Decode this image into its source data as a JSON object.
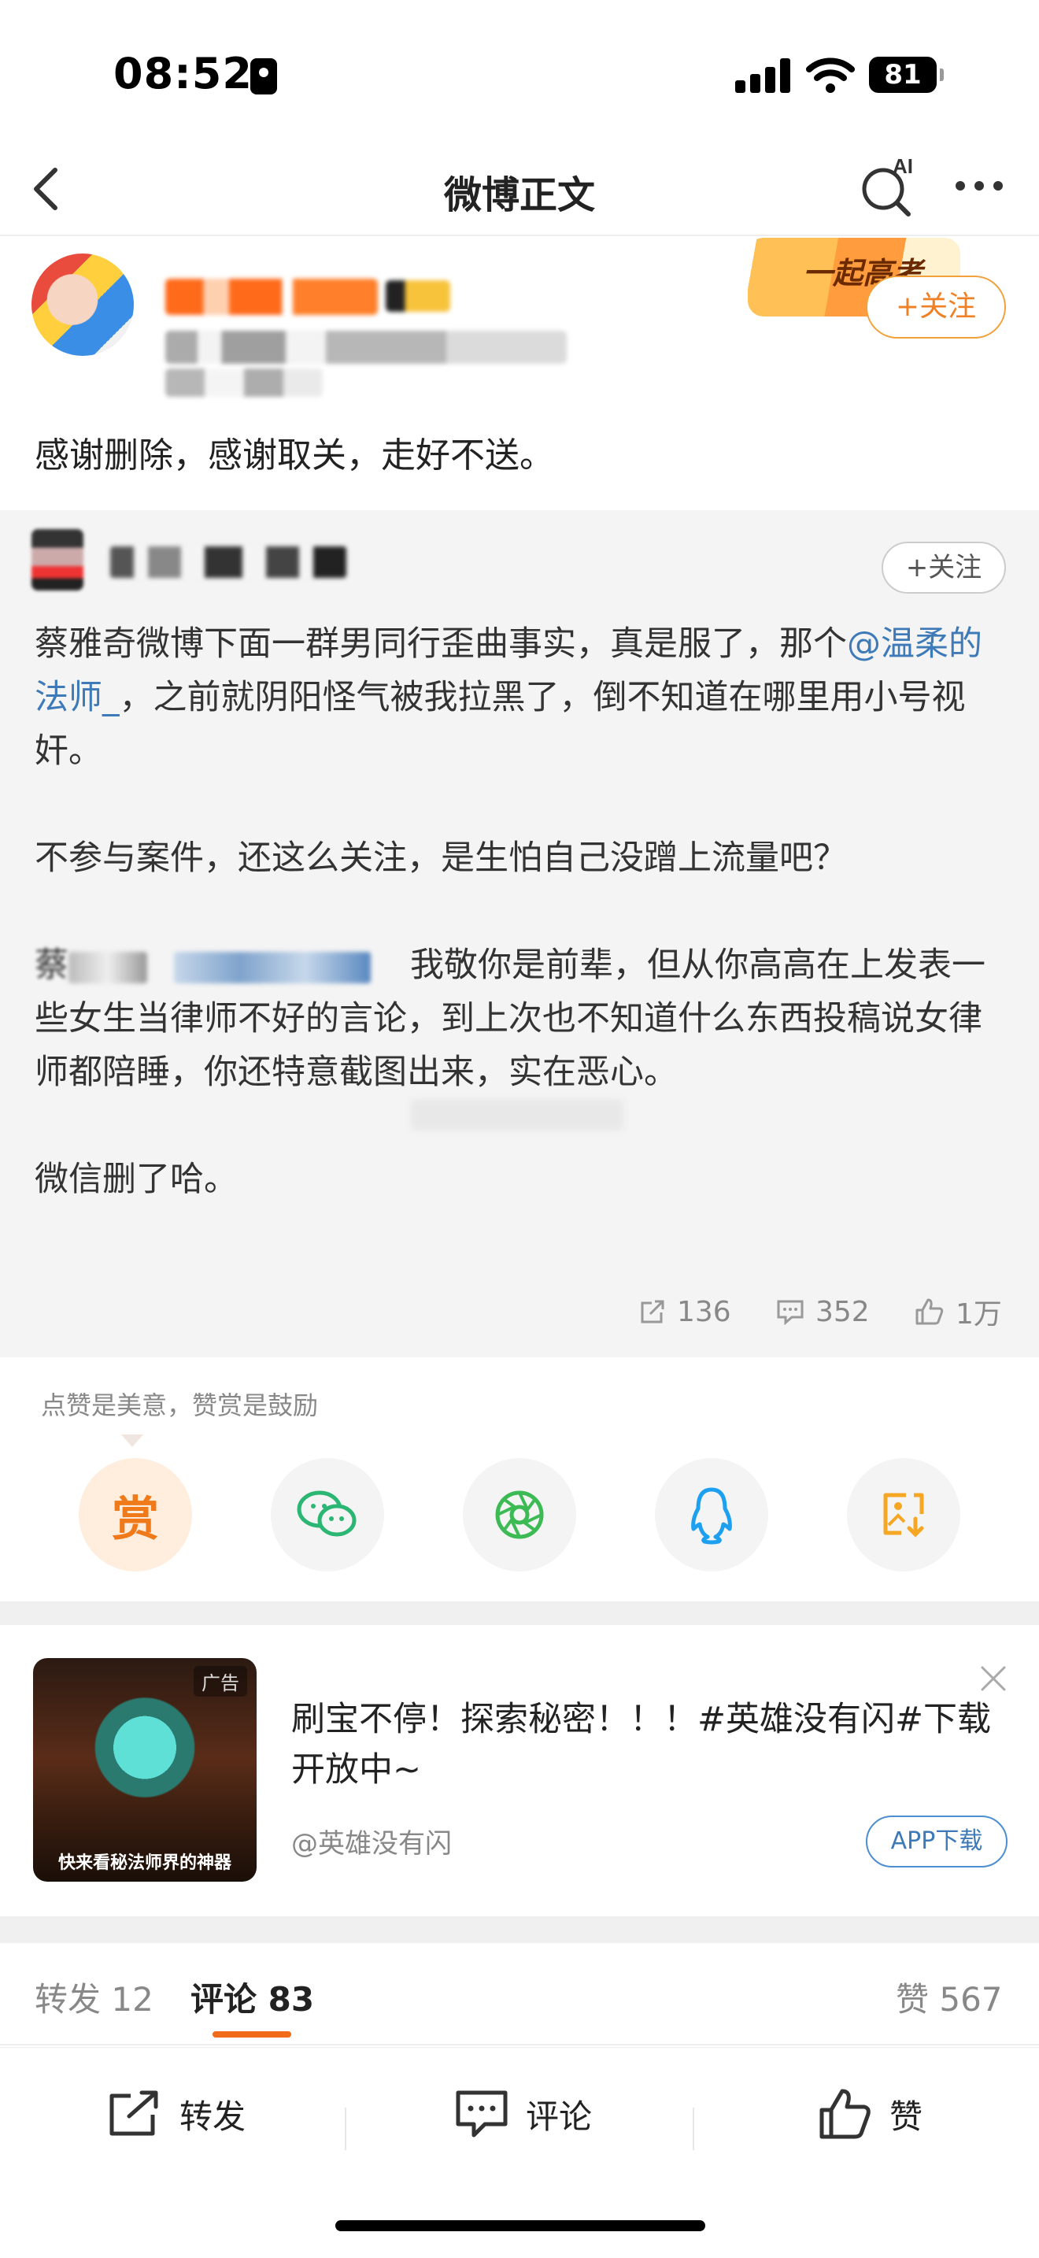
{
  "status_bar": {
    "time": "08:52",
    "battery": "81"
  },
  "nav": {
    "title": "微博正文",
    "ai_label": "AI"
  },
  "post": {
    "follow_art_text": "一起高考",
    "follow_label": "+关注",
    "text": "感谢删除，感谢取关，走好不送。"
  },
  "repost": {
    "follow_label": "+关注",
    "p1_a": "蔡雅奇微博下面一群男同行歪曲事实，真是服了，那个",
    "p1_mention": "@温柔的法师_",
    "p1_b": "，之前就阴阳怪气被我拉黑了，倒不知道在哪里用小号视奸。",
    "p2": "不参与案件，还这么关注，是生怕自己没蹭上流量吧？",
    "p3_prefix": "蔡",
    "p3_b": "我敬你是前辈，但从你高高在上发表一些女生当律师不好的言论，到上次也不知道什么东西投稿说女律师都陪睡，你还特意截图出来，实在恶心。",
    "p4": "微信删了哈。",
    "stats": {
      "reposts": "136",
      "comments": "352",
      "likes": "1万"
    }
  },
  "reward": {
    "tip": "点赞是美意，赞赏是鼓励",
    "reward_label": "赏",
    "icons": [
      "wechat-icon",
      "moments-icon",
      "qq-icon",
      "save-image-icon"
    ]
  },
  "ad": {
    "tag": "广告",
    "caption": "快来看秘法师界的神器",
    "text": "刷宝不停！探索秘密！！！#英雄没有闪#下载开放中~",
    "source": "@英雄没有闪",
    "button": "APP下载"
  },
  "tabs": {
    "repost": "转发 12",
    "comment": "评论 83",
    "like": "赞 567"
  },
  "bottom_bar": {
    "repost": "转发",
    "comment": "评论",
    "like": "赞"
  },
  "colors": {
    "accent": "#f06a1a",
    "link": "#3e7ab7",
    "reward_bg": "#ffeede"
  }
}
